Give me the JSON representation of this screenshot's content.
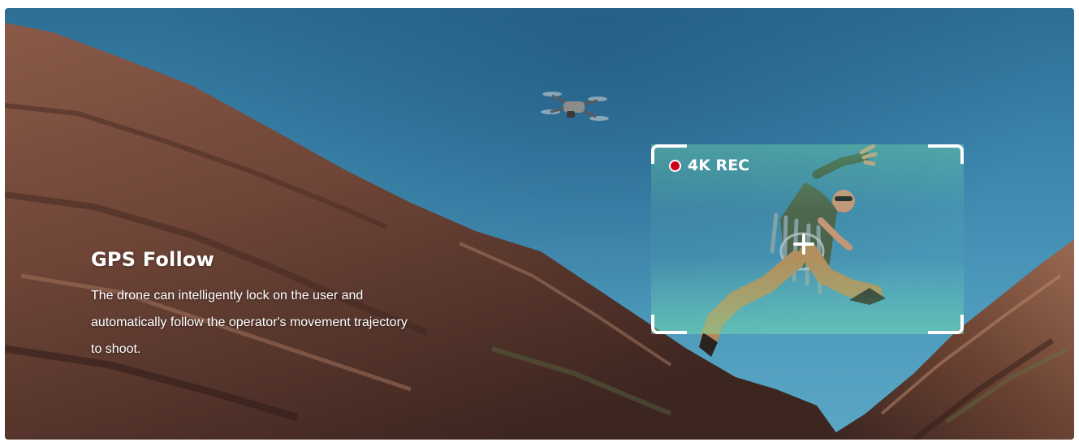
{
  "feature": {
    "title": "GPS Follow",
    "description": "The drone can intelligently lock on the user and automatically follow the operator's movement trajectory to shoot."
  },
  "overlay": {
    "rec_label": "4K REC",
    "rec_color": "#d0021b",
    "frame_accent": "#78e6aa"
  },
  "icons": {
    "drone": "drone-icon",
    "record": "record-dot-icon",
    "target": "crosshair-icon"
  },
  "colors": {
    "sky": "#3b86ad",
    "rock": "#6b4335",
    "text": "#ffffff"
  }
}
